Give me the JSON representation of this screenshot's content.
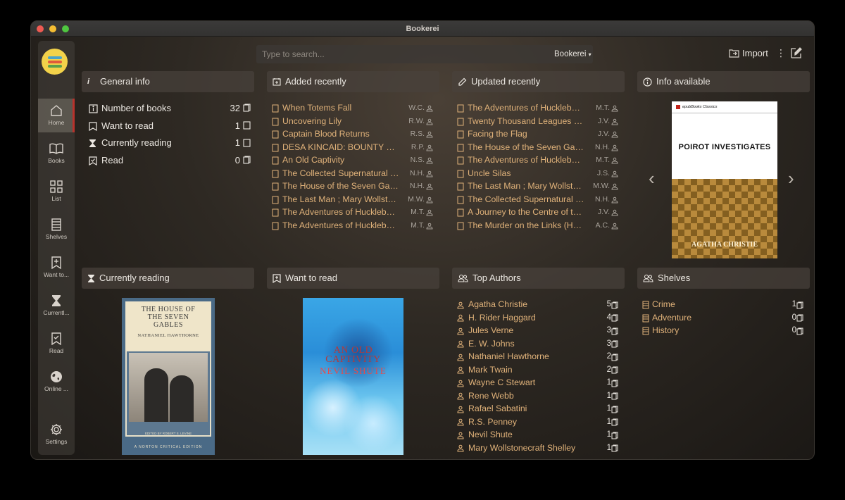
{
  "app": {
    "title": "Bookerei"
  },
  "colors": {
    "accent": "#e0b27a",
    "active_marker": "#b8322c",
    "logo": "#f2d24a"
  },
  "sidebar": {
    "items": [
      {
        "label": "Home",
        "icon": "home-icon",
        "active": true
      },
      {
        "label": "Books",
        "icon": "open-book-icon"
      },
      {
        "label": "List",
        "icon": "grid-list-icon"
      },
      {
        "label": "Shelves",
        "icon": "shelves-icon"
      },
      {
        "label": "Want to...",
        "icon": "bookmark-plus-icon"
      },
      {
        "label": "Currentl...",
        "icon": "hourglass-icon"
      },
      {
        "label": "Read",
        "icon": "bookmark-check-icon"
      },
      {
        "label": "Online ...",
        "icon": "globe-icon"
      },
      {
        "label": "Settings",
        "icon": "gear-icon"
      }
    ]
  },
  "toolbar": {
    "search_placeholder": "Type to search...",
    "library": "Bookerei",
    "import_label": "Import"
  },
  "general_info": {
    "title": "General info",
    "rows": [
      {
        "label": "Number of books",
        "count": "32",
        "icon": "info-icon"
      },
      {
        "label": "Want to read",
        "count": "1",
        "icon": "bookmark-icon"
      },
      {
        "label": "Currently reading",
        "count": "1",
        "icon": "hourglass-icon"
      },
      {
        "label": "Read",
        "count": "0",
        "icon": "bookmark-check-icon"
      }
    ]
  },
  "added_recently": {
    "title": "Added recently",
    "books": [
      {
        "title": "When Totems Fall",
        "author": "W.C."
      },
      {
        "title": "Uncovering Lily",
        "author": "R.W."
      },
      {
        "title": "Captain Blood Returns",
        "author": "R.S."
      },
      {
        "title": "DESA KINCAID: BOUNTY HUNTER",
        "author": "R.P."
      },
      {
        "title": "An Old Captivity",
        "author": "N.S."
      },
      {
        "title": "The Collected Supernatural and...",
        "author": "N.H."
      },
      {
        "title": "The House of the Seven Gables",
        "author": "N.H."
      },
      {
        "title": "The Last Man ; Mary Wollstone...",
        "author": "M.W."
      },
      {
        "title": "The Adventures of Huckleberry ...",
        "author": "M.T."
      },
      {
        "title": "The Adventures of Huckleberry ...",
        "author": "M.T."
      }
    ]
  },
  "updated_recently": {
    "title": "Updated recently",
    "books": [
      {
        "title": "The Adventures of Huckleberry ...",
        "author": "M.T."
      },
      {
        "title": "Twenty Thousand Leagues Unde...",
        "author": "J.V."
      },
      {
        "title": "Facing the Flag",
        "author": "J.V."
      },
      {
        "title": "The House of the Seven Gables",
        "author": "N.H."
      },
      {
        "title": "The Adventures of Huckleberry ...",
        "author": "M.T."
      },
      {
        "title": "Uncle Silas",
        "author": "J.S."
      },
      {
        "title": "The Last Man ; Mary Wollstone...",
        "author": "M.W."
      },
      {
        "title": "The Collected Supernatural and...",
        "author": "N.H."
      },
      {
        "title": "A Journey to the Centre of the E...",
        "author": "J.V."
      },
      {
        "title": "The Murder on the Links (Hercul...",
        "author": "A.C."
      }
    ]
  },
  "info_available": {
    "title": "Info available",
    "cover": {
      "publisher": "epubBooks Classics",
      "title": "POIROT INVESTIGATES",
      "author": "AGATHA CHRISTIE"
    }
  },
  "currently_reading": {
    "title": "Currently reading",
    "cover": {
      "title_line1": "THE HOUSE OF",
      "title_line2": "THE SEVEN",
      "title_line3": "GABLES",
      "author": "NATHANIEL HAWTHORNE",
      "editor": "EDITED BY ROBERT S. LEVINE",
      "series": "A NORTON CRITICAL EDITION"
    }
  },
  "want_to_read": {
    "title": "Want to read",
    "cover": {
      "title_line1": "AN OLD",
      "title_line2": "CAPTIVITY",
      "author": "NEVIL SHUTE"
    }
  },
  "top_authors": {
    "title": "Top Authors",
    "authors": [
      {
        "name": "Agatha Christie",
        "count": "5"
      },
      {
        "name": "H. Rider Haggard",
        "count": "4"
      },
      {
        "name": "Jules Verne",
        "count": "3"
      },
      {
        "name": "E. W. Johns",
        "count": "3"
      },
      {
        "name": "Nathaniel Hawthorne",
        "count": "2"
      },
      {
        "name": "Mark Twain",
        "count": "2"
      },
      {
        "name": "Wayne C Stewart",
        "count": "1"
      },
      {
        "name": "Rene Webb",
        "count": "1"
      },
      {
        "name": "Rafael Sabatini",
        "count": "1"
      },
      {
        "name": "R.S. Penney",
        "count": "1"
      },
      {
        "name": "Nevil Shute",
        "count": "1"
      },
      {
        "name": "Mary Wollstonecraft Shelley",
        "count": "1"
      }
    ]
  },
  "shelves": {
    "title": "Shelves",
    "items": [
      {
        "name": "Crime",
        "count": "1"
      },
      {
        "name": "Adventure",
        "count": "0"
      },
      {
        "name": "History",
        "count": "0"
      }
    ]
  }
}
